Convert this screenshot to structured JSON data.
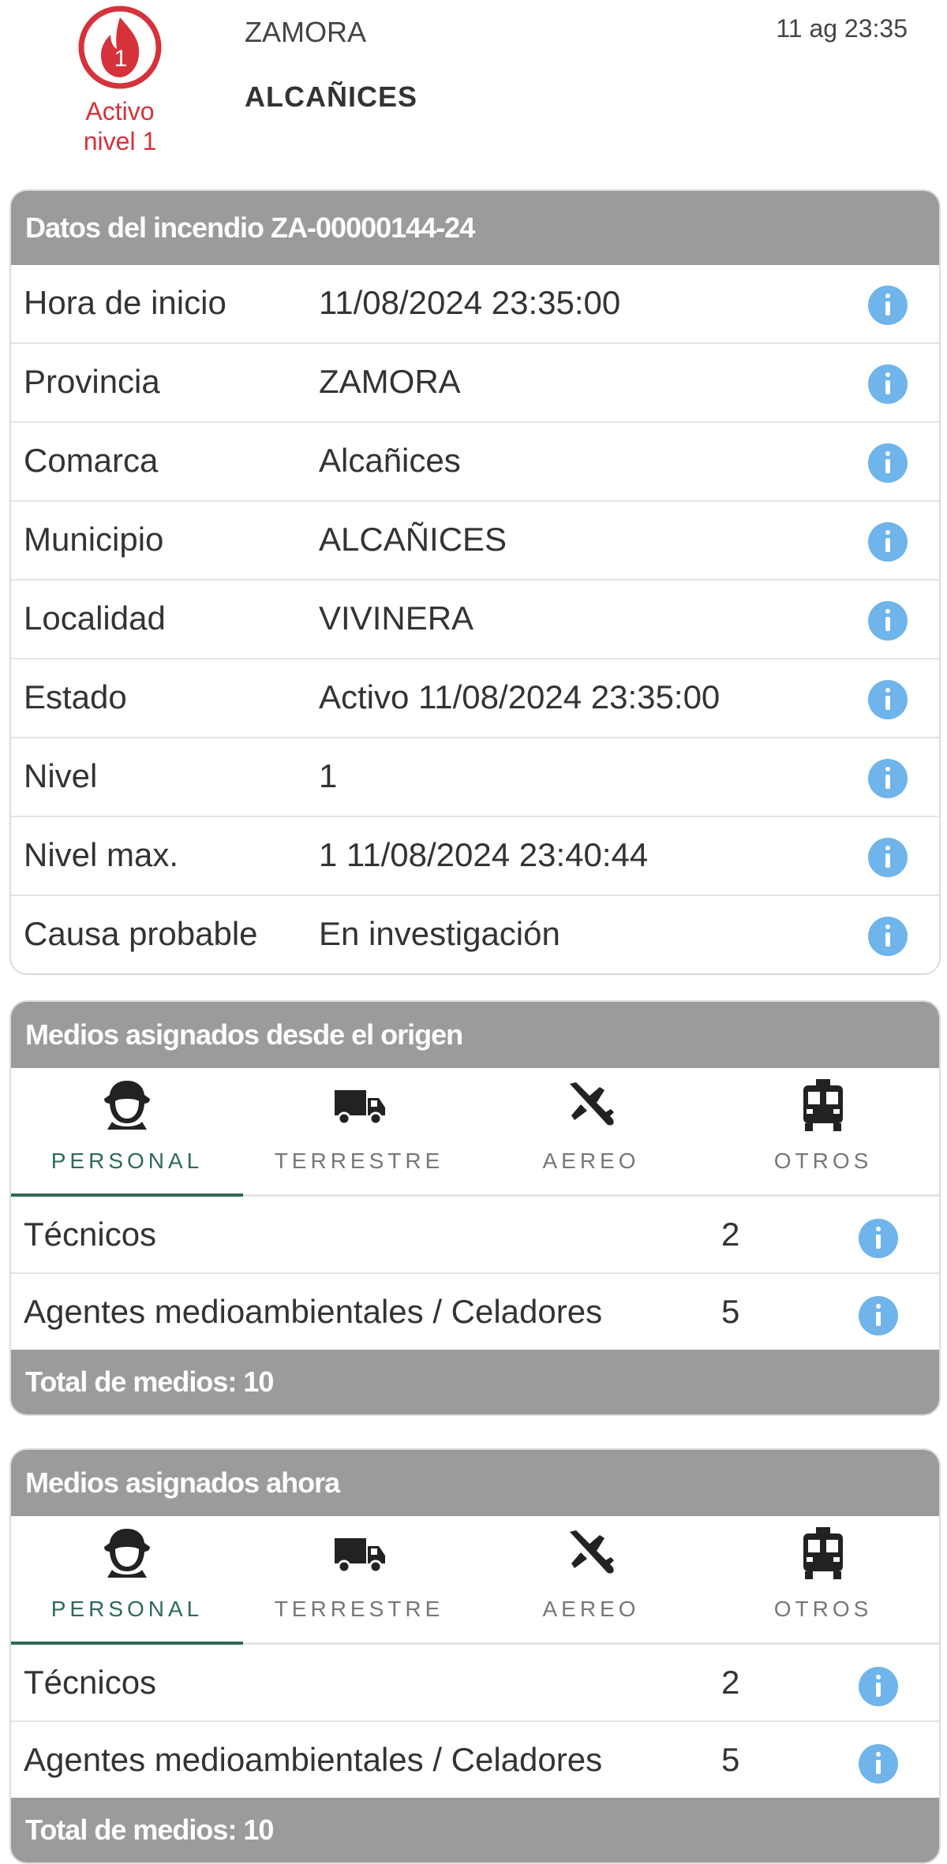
{
  "header": {
    "badge_number": "1",
    "status_line1": "Activo",
    "status_line2": "nivel 1",
    "province": "ZAMORA",
    "municipality": "ALCAÑICES",
    "datetime": "11 ag 23:35"
  },
  "colors": {
    "accent_red": "#d6323a",
    "header_gray": "#9b9b9b",
    "info_blue": "#6fb4ea",
    "tab_active_green": "#2d6b55"
  },
  "incident": {
    "title": "Datos del incendio ZA-00000144-24",
    "rows": [
      {
        "label": "Hora de inicio",
        "value": "11/08/2024 23:35:00"
      },
      {
        "label": "Provincia",
        "value": "ZAMORA"
      },
      {
        "label": "Comarca",
        "value": "Alcañices"
      },
      {
        "label": "Municipio",
        "value": "ALCAÑICES"
      },
      {
        "label": "Localidad",
        "value": "VIVINERA"
      },
      {
        "label": "Estado",
        "value": "Activo 11/08/2024 23:35:00"
      },
      {
        "label": "Nivel",
        "value": "1"
      },
      {
        "label": "Nivel max.",
        "value": "1 11/08/2024 23:40:44"
      },
      {
        "label": "Causa probable",
        "value": "En investigación"
      }
    ]
  },
  "tabs": [
    {
      "label": "PERSONAL",
      "icon": "firefighter-icon"
    },
    {
      "label": "TERRESTRE",
      "icon": "truck-icon"
    },
    {
      "label": "AEREO",
      "icon": "plane-icon"
    },
    {
      "label": "OTROS",
      "icon": "vehicle-icon"
    }
  ],
  "origin": {
    "title": "Medios asignados desde el origen",
    "active_tab": "PERSONAL",
    "rows": [
      {
        "label": "Técnicos",
        "count": "2"
      },
      {
        "label": "Agentes medioambientales / Celadores",
        "count": "5"
      }
    ],
    "total": "Total de medios: 10"
  },
  "now": {
    "title": "Medios asignados ahora",
    "active_tab": "PERSONAL",
    "rows": [
      {
        "label": "Técnicos",
        "count": "2"
      },
      {
        "label": "Agentes medioambientales / Celadores",
        "count": "5"
      }
    ],
    "total": "Total de medios: 10"
  }
}
